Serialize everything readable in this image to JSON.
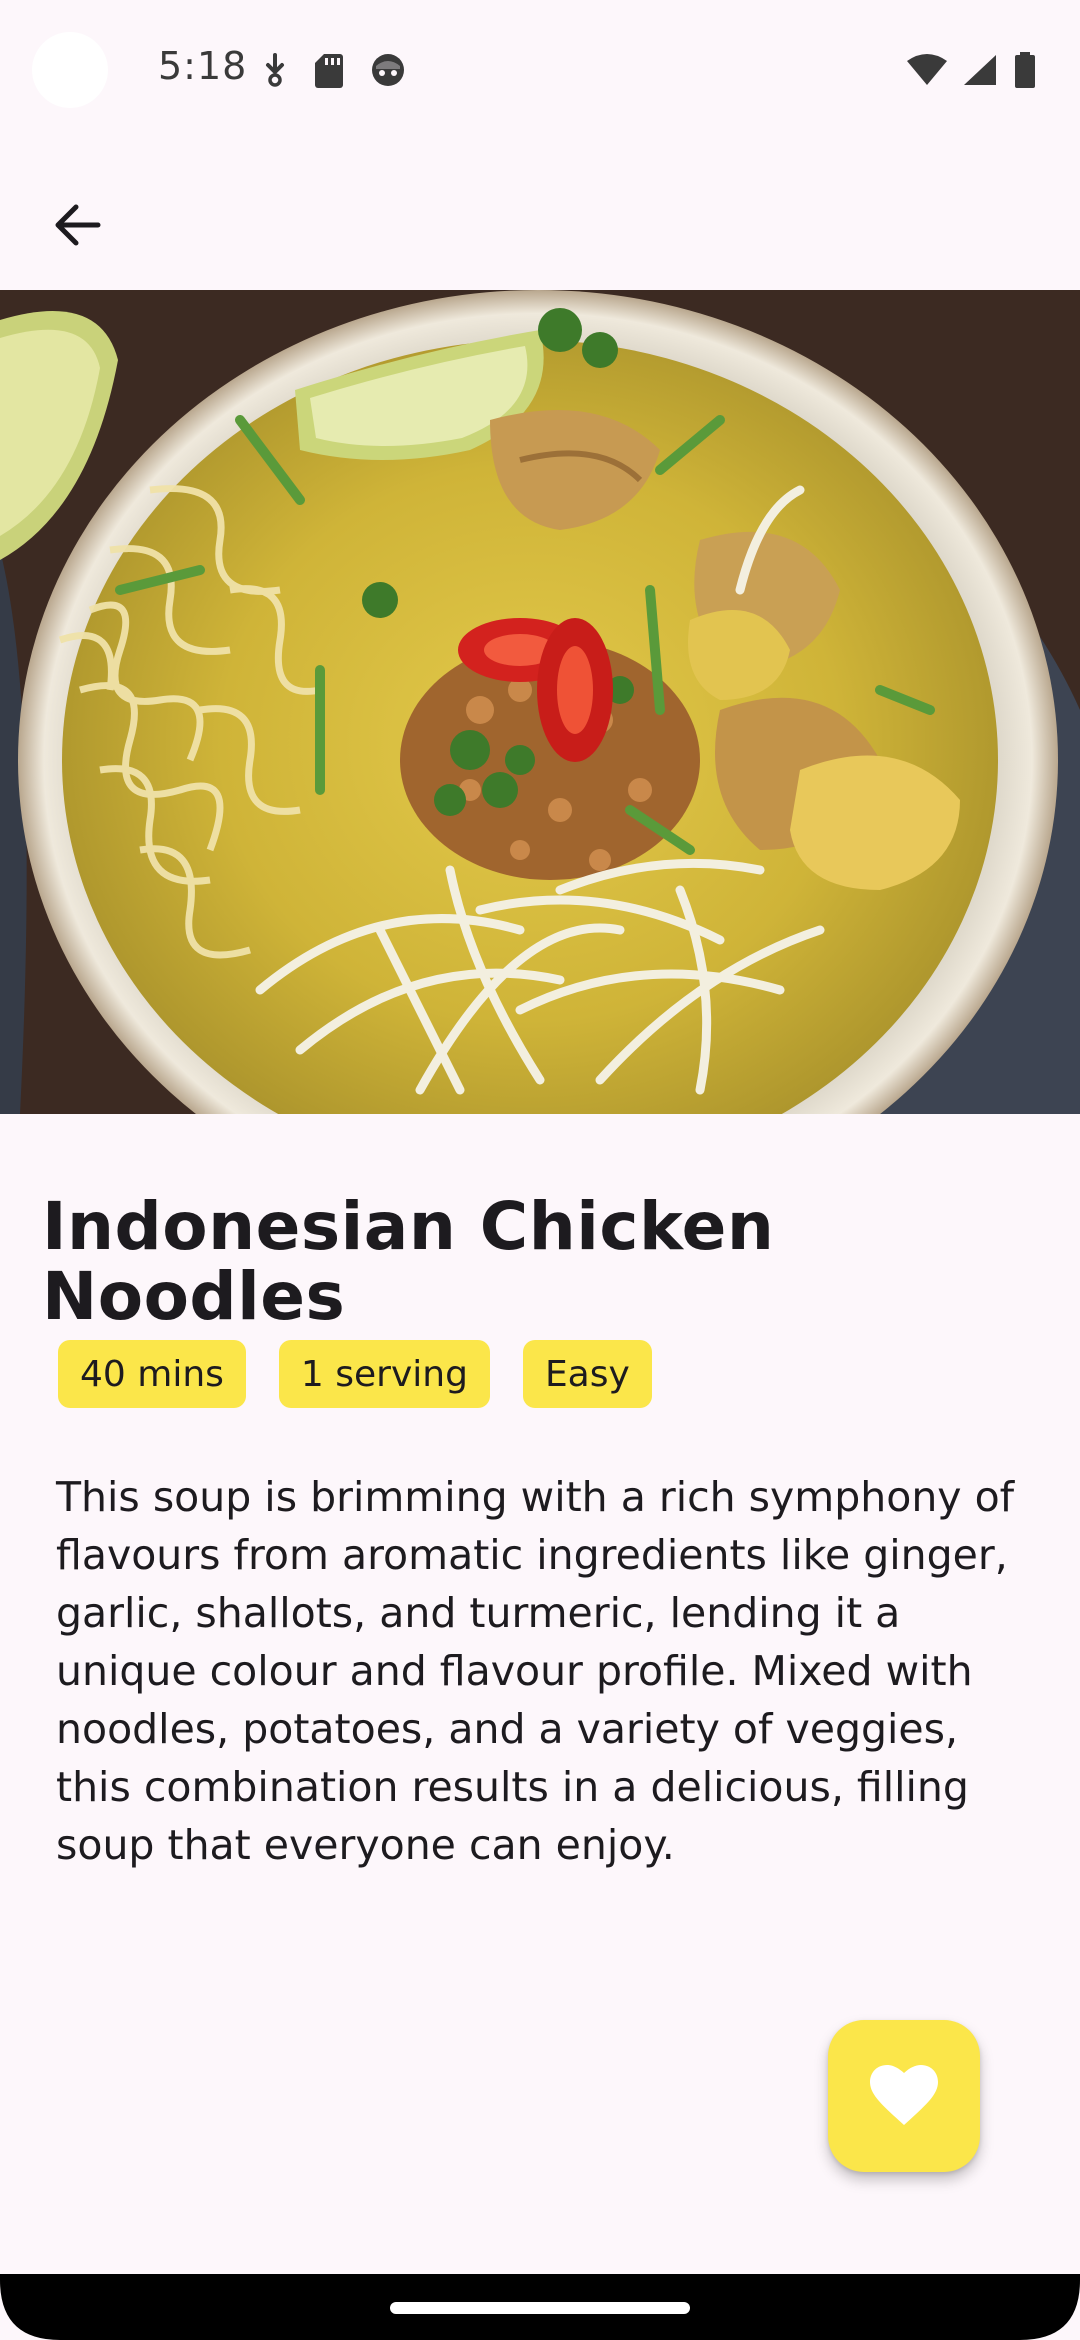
{
  "status_bar": {
    "time": "5:18",
    "left_icons": [
      "download-icon",
      "sd-card-icon",
      "face-icon"
    ],
    "right_icons": [
      "wifi-icon",
      "cell-signal-icon",
      "battery-icon"
    ]
  },
  "app_bar": {
    "back_icon": "arrow-back-icon"
  },
  "recipe": {
    "image_alt": "Indonesian Chicken Noodles soup bowl",
    "title": "Indonesian Chicken Noodles",
    "chips": [
      "40 mins",
      "1 serving",
      "Easy"
    ],
    "description": "This soup is brimming with a rich symphony of flavours from aromatic ingredients like ginger, garlic, shallots, and turmeric, lending it a unique colour and flavour profile. Mixed with noodles, potatoes, and a variety of veggies, this combination results in a delicious, filling soup that everyone can enjoy."
  },
  "fab": {
    "icon": "heart-icon"
  },
  "colors": {
    "background": "#fdf7fb",
    "accent": "#fbe64a",
    "text": "#1d1b1f"
  }
}
